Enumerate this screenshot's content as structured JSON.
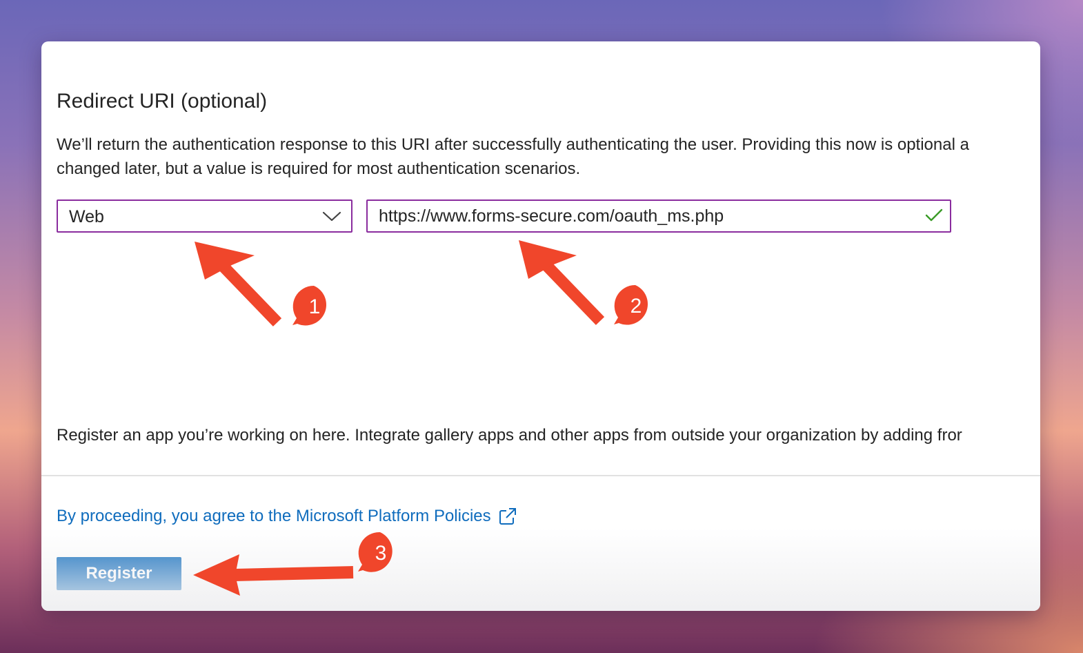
{
  "section": {
    "heading": "Redirect URI (optional)",
    "description_line1": "We’ll return the authentication response to this URI after successfully authenticating the user. Providing this now is optional a",
    "description_line2": "changed later, but a value is required for most authentication scenarios."
  },
  "platform_select": {
    "value": "Web",
    "icon": "chevron-down-icon"
  },
  "redirect_uri": {
    "value": "https://www.forms-secure.com/oauth_ms.php",
    "valid_icon": "checkmark-icon"
  },
  "register_info": "Register an app you’re working on here. Integrate gallery apps and other apps from outside your organization by adding fror",
  "footer": {
    "policy_link": "By proceeding, you agree to the Microsoft Platform Policies",
    "policy_icon": "external-link-icon",
    "register_label": "Register"
  },
  "annotations": {
    "badge_1": "1",
    "badge_2": "2",
    "badge_3": "3"
  },
  "colors": {
    "accent_blue": "#0f6cbd",
    "focus_border": "#8a2c9e",
    "valid_green": "#3a9b27",
    "annotation_red": "#f0462b"
  }
}
